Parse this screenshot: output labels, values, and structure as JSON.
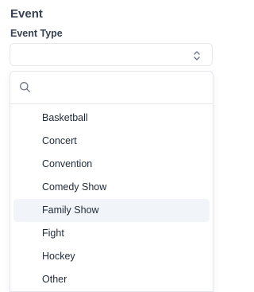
{
  "section": {
    "title": "Event"
  },
  "event_type": {
    "label": "Event Type",
    "value": "",
    "search_placeholder": "",
    "options": [
      {
        "label": "Basketball"
      },
      {
        "label": "Concert"
      },
      {
        "label": "Convention"
      },
      {
        "label": "Comedy Show"
      },
      {
        "label": "Family Show"
      },
      {
        "label": "Fight"
      },
      {
        "label": "Hockey"
      },
      {
        "label": "Other"
      }
    ],
    "highlighted_index": 4
  },
  "icons": {
    "trigger": "chevron-up-down-icon",
    "search": "search-icon"
  },
  "colors": {
    "border": "#e5e7eb",
    "highlight": "#f1f5f9",
    "text": "#1f2937",
    "label": "#374151"
  }
}
